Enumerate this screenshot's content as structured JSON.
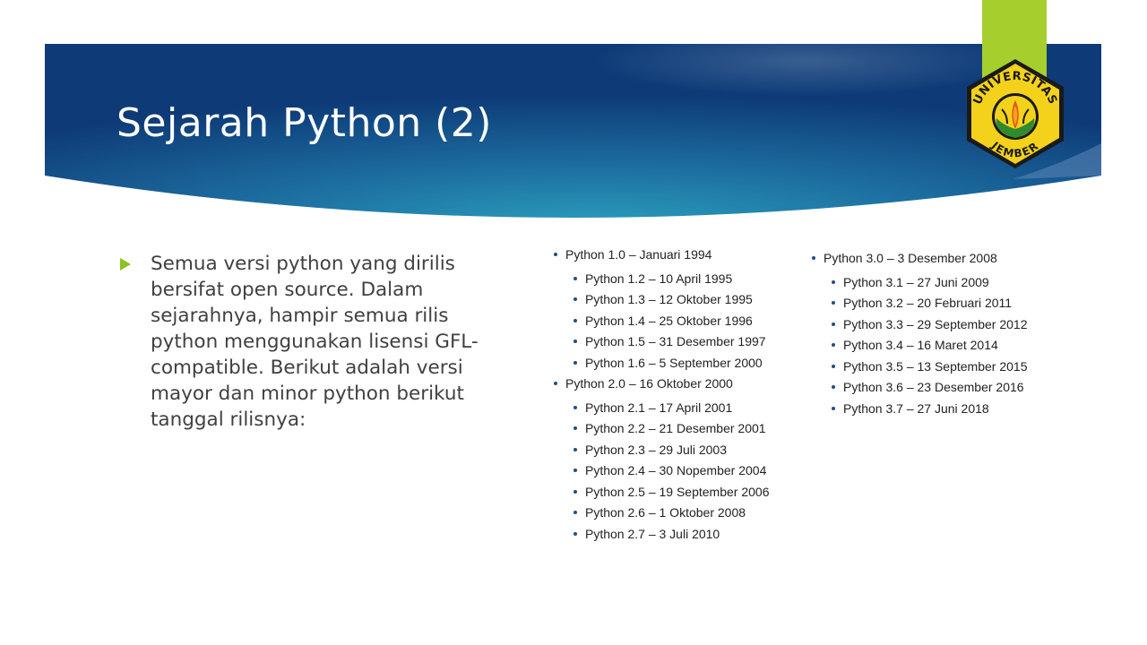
{
  "slide": {
    "title": "Sejarah Python (2)",
    "body": "Semua versi python yang dirilis bersifat open source. Dalam sejarahnya, hampir semua rilis python menggunakan lisensi GFL-compatible. Berikut adalah versi mayor dan minor python berikut tanggal rilisnya:"
  },
  "logo": {
    "top_text": "UNIVERSITAS",
    "bottom_text": "JEMBER"
  },
  "colors": {
    "banner_dark": "#0e3b78",
    "banner_light": "#2a9dbb",
    "accent_green": "#a6cf2e",
    "text": "#404040"
  },
  "versions": {
    "left": [
      {
        "level": 1,
        "text": "Python 1.0 – Januari 1994"
      },
      {
        "level": 2,
        "text": "Python 1.2 – 10 April 1995"
      },
      {
        "level": 2,
        "text": "Python 1.3 – 12 Oktober 1995"
      },
      {
        "level": 2,
        "text": "Python 1.4 – 25 Oktober 1996"
      },
      {
        "level": 2,
        "text": "Python 1.5 – 31 Desember 1997"
      },
      {
        "level": 2,
        "text": "Python 1.6 – 5 September 2000"
      },
      {
        "level": 1,
        "text": "Python 2.0 – 16 Oktober 2000"
      },
      {
        "level": 2,
        "text": "Python 2.1 – 17 April 2001"
      },
      {
        "level": 2,
        "text": "Python 2.2 – 21 Desember 2001"
      },
      {
        "level": 2,
        "text": "Python 2.3 – 29 Juli 2003"
      },
      {
        "level": 2,
        "text": "Python 2.4 – 30 Nopember 2004"
      },
      {
        "level": 2,
        "text": "Python 2.5 – 19 September 2006"
      },
      {
        "level": 2,
        "text": "Python 2.6 – 1 Oktober 2008"
      },
      {
        "level": 2,
        "text": "Python 2.7 – 3 Juli 2010"
      }
    ],
    "right": [
      {
        "level": 1,
        "text": "Python 3.0 – 3 Desember 2008"
      },
      {
        "level": 2,
        "text": "Python 3.1 – 27 Juni 2009"
      },
      {
        "level": 2,
        "text": "Python 3.2 – 20 Februari 2011"
      },
      {
        "level": 2,
        "text": "Python 3.3 – 29 September 2012"
      },
      {
        "level": 2,
        "text": "Python 3.4 – 16 Maret 2014"
      },
      {
        "level": 2,
        "text": "Python 3.5 – 13 September 2015"
      },
      {
        "level": 2,
        "text": "Python 3.6 – 23 Desember 2016"
      },
      {
        "level": 2,
        "text": "Python 3.7 – 27 Juni 2018"
      }
    ]
  }
}
